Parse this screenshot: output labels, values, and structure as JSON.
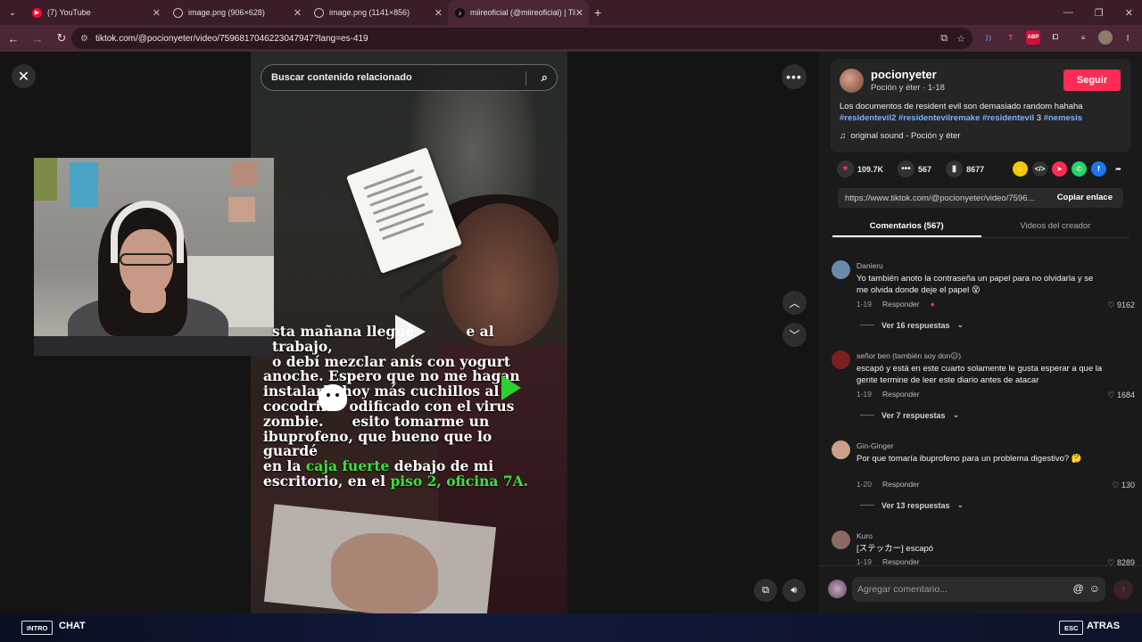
{
  "browser": {
    "tabs": [
      {
        "title": "(7) YouTube",
        "favicon": "youtube-icon"
      },
      {
        "title": "image.png (906×628)",
        "favicon": "globe-icon"
      },
      {
        "title": "image.png (1141×856)",
        "favicon": "globe-icon"
      },
      {
        "title": "miireoficial (@miireoficial) | Tik",
        "favicon": "tiktok-icon"
      }
    ],
    "url": "tiktok.com/@pocionyeter/video/7596817046223047947?lang=es-419"
  },
  "video": {
    "search_placeholder": "Buscar contenido relacionado",
    "text_line1": "sta mañana llegué",
    "text_line1b": "e al trabajo,",
    "text_line2": "o debí mezclar anís con yogurt",
    "text_line3": "anoche. Espero que no me hagan",
    "text_line4": "instalarle hoy más cuchillos al",
    "text_line5": "cocodril",
    "text_line5b": "odificado con el virus",
    "text_line6": "zombie.",
    "text_line6b": "esito tomarme un",
    "text_line7": "ibuprofeno, que bueno que lo guardé",
    "text_line8_a": "en la ",
    "text_line8_green": "caja fuerte",
    "text_line8_b": " debajo de mi",
    "text_line9_a": "escritorio, en el ",
    "text_line9_green": "piso 2, oficina 7A."
  },
  "author": {
    "username": "pocionyeter",
    "subtitle": "Poción y éter · 1-18",
    "follow_label": "Seguir",
    "desc_text": "Los documentos de resident evil son demasiado random hahaha",
    "tag1": "#residentevil2",
    "tag2": "#residentevilremake",
    "tag3": "#residentevil",
    "tag3_suffix": "3",
    "tag4": "#nemesis",
    "sound": "original sound - Poción y éter"
  },
  "stats": {
    "likes": "109.7K",
    "comments": "567",
    "saves": "8677"
  },
  "share": {
    "link": "https://www.tiktok.com/@pocionyeter/video/7596...",
    "copy_label": "Copiar enlace"
  },
  "tabs": {
    "comments_tab": "Comentarios (567)",
    "creator_tab": "Videos del creador"
  },
  "comments": [
    {
      "user": "Danieru",
      "text": "Yo también anoto la contraseña un papel para no olvidarla y se me olvida donde deje el papel 😵",
      "date": "1-19",
      "reply": "Responder",
      "likes": "9162",
      "replies": "Ver 16 respuestas"
    },
    {
      "user": "señor ben (también soy don😐)",
      "text": "escapó y está en este cuarto solamente le gusta esperar a que la gente termine de leer este diario antes de atacar",
      "date": "1-19",
      "reply": "Responder",
      "likes": "1684",
      "replies": "Ver 7 respuestas"
    },
    {
      "user": "Gin-Ginger",
      "text": "Por que tomaría ibuprofeno para un problema digestivo? 🤔",
      "date": "1-20",
      "reply": "Responder",
      "likes": "130",
      "replies": "Ver 13 respuestas"
    },
    {
      "user": "Kuro",
      "text": "[ステッカー] escapó",
      "date": "1-19",
      "reply": "Responder",
      "likes": "8289"
    }
  ],
  "composer": {
    "placeholder": "Agregar comentario..."
  },
  "overlay": {
    "left_key": "INTRO",
    "left_label": "CHAT",
    "right_key": "ESC",
    "right_label": "ATRAS"
  },
  "colors": {
    "accent": "#fe2c55",
    "hashtag": "#7fb0ff",
    "highlight_green": "#3ce13c"
  }
}
